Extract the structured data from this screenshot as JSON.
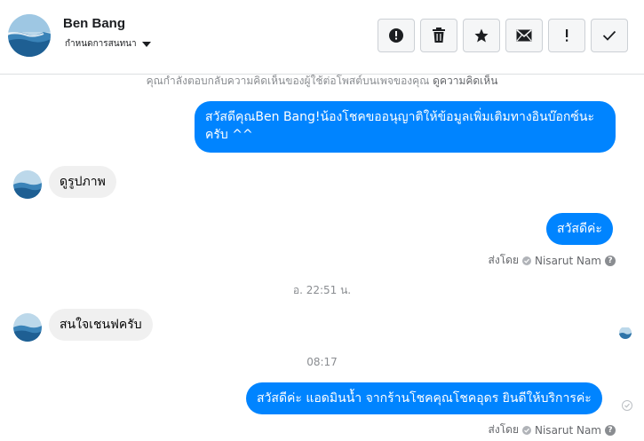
{
  "header": {
    "contact_name": "Ben Bang",
    "subtitle": "กำหนดการสนทนา",
    "toolbar": [
      {
        "name": "report-spam-button",
        "icon": "alert-circle-icon"
      },
      {
        "name": "delete-button",
        "icon": "trash-icon"
      },
      {
        "name": "star-button",
        "icon": "star-icon"
      },
      {
        "name": "mark-unread-button",
        "icon": "envelope-icon"
      },
      {
        "name": "follow-up-button",
        "icon": "exclamation-icon"
      },
      {
        "name": "mark-done-button",
        "icon": "check-icon"
      }
    ]
  },
  "notice": {
    "text": "คุณกำลังตอบกลับความคิดเห็นของผู้ใช้ต่อโพสต์บนเพจของคุณ",
    "link": "ดูความคิดเห็น"
  },
  "messages": [
    {
      "direction": "out",
      "text": "สวัสดีคุณBen Bang!น้องโชคขออนุญาติให้ข้อมูลเพิ่มเติมทางอินบ๊อกซ์นะครับ ^^"
    },
    {
      "direction": "in",
      "text": "ดูรูปภาพ"
    },
    {
      "direction": "out",
      "text": "สวัสดีค่ะ"
    },
    {
      "direction": "in",
      "text": "สนใจเชนฟครับ"
    },
    {
      "direction": "out",
      "text": "สวัสดีค่ะ แอดมินน้ำ จากร้านโชคคุณโชคอุดร ยินดีให้บริการค่ะ"
    }
  ],
  "sent_by": {
    "prefix": "ส่งโดย",
    "agent": "Nisarut Nam",
    "help": "?"
  },
  "timestamps": [
    "อ. 22:51 น.",
    "08:17"
  ],
  "colors": {
    "accent": "#0084ff",
    "incoming": "#f0f0f0",
    "muted": "#65676b"
  }
}
